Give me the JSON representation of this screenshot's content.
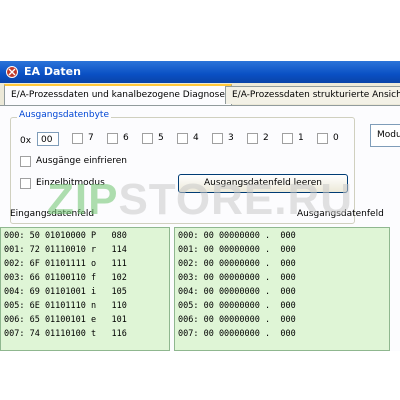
{
  "window": {
    "title": "EA Daten"
  },
  "tabs": [
    {
      "label": "E/A-Prozessdaten und kanalbezogene Diagnose"
    },
    {
      "label": "E/A-Prozessdaten strukturierte Ansicht"
    }
  ],
  "group": {
    "label": "Ausgangsdatenbyte",
    "hex_prefix": "0x",
    "hex_value": "00",
    "bits": [
      "7",
      "6",
      "5",
      "4",
      "3",
      "2",
      "1",
      "0"
    ]
  },
  "checkboxes": {
    "freeze": "Ausgänge einfrieren",
    "single_bit": "Einzelbitmodus"
  },
  "buttons": {
    "clear": "Ausgangsdatenfeld leeren"
  },
  "modul": "Modu",
  "input_field": {
    "label": "Eingangsdatenfeld",
    "rows": [
      "000: 50 01010000 P   080",
      "001: 72 01110010 r   114",
      "002: 6F 01101111 o   111",
      "003: 66 01100110 f   102",
      "004: 69 01101001 i   105",
      "005: 6E 01101110 n   110",
      "006: 65 01100101 e   101",
      "007: 74 01110100 t   116"
    ]
  },
  "output_field": {
    "label": "Ausgangsdatenfeld",
    "rows": [
      "000: 00 00000000 .  000",
      "001: 00 00000000 .  000",
      "002: 00 00000000 .  000",
      "003: 00 00000000 .  000",
      "004: 00 00000000 .  000",
      "005: 00 00000000 .  000",
      "006: 00 00000000 .  000",
      "007: 00 00000000 .  000"
    ]
  },
  "watermark": {
    "prefix": "ZIP",
    "rest": "STORE.RU"
  },
  "colors": {
    "title_bar": "#0a50c4",
    "list_bg": "#dff5d6",
    "group_label": "#0046d5"
  }
}
